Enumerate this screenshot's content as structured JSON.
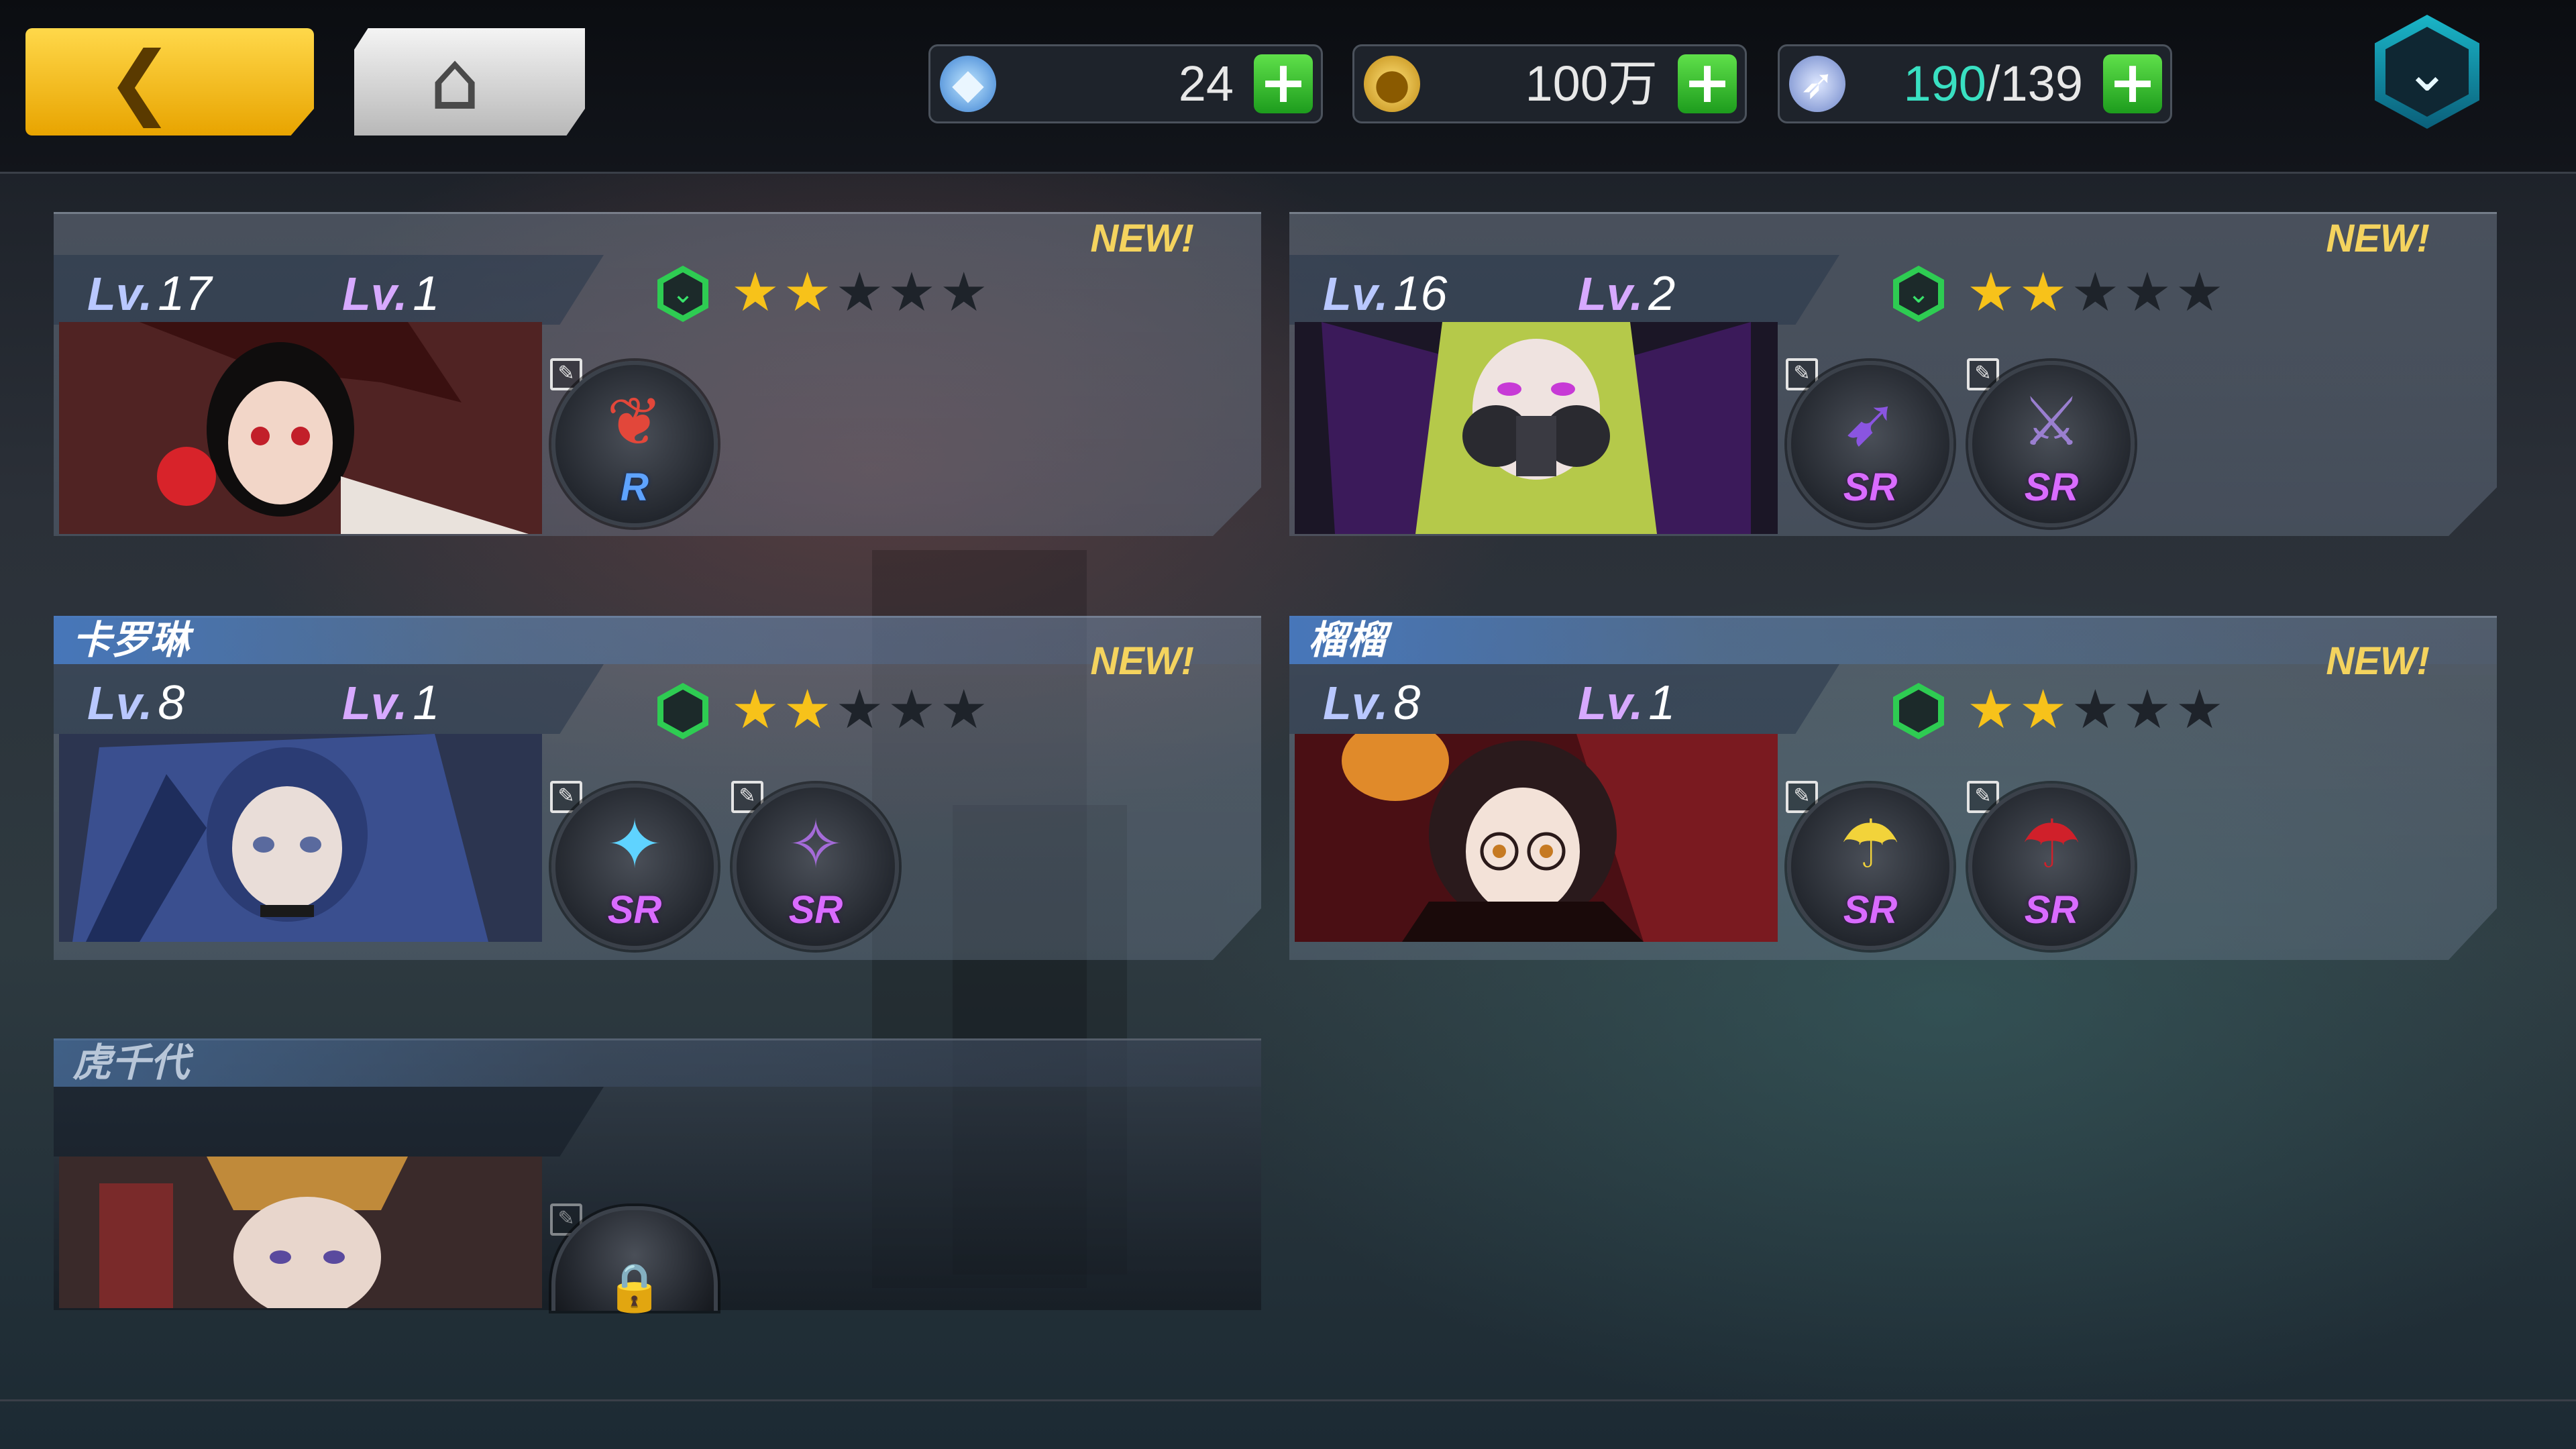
{
  "header": {
    "back_icon": "back-arrow-icon",
    "home_icon": "home-icon",
    "resources": [
      {
        "icon": "diamond-icon",
        "value": "24"
      },
      {
        "icon": "gold-coin-icon",
        "value": "100万"
      },
      {
        "icon": "stamina-icon",
        "current": "190",
        "separator": "/",
        "max": "139"
      }
    ],
    "menu_icon": "shield-chevron-icon"
  },
  "cards": [
    {
      "name": "",
      "new_badge": "NEW!",
      "level_label": "Lv.",
      "level": "17",
      "breakthrough_label": "Lv.",
      "breakthrough": "1",
      "stars_filled": 2,
      "stars_total": 5,
      "equipment": [
        {
          "rarity": "R",
          "icon": "rose-staff-icon"
        }
      ]
    },
    {
      "name": "",
      "new_badge": "NEW!",
      "level_label": "Lv.",
      "level": "16",
      "breakthrough_label": "Lv.",
      "breakthrough": "2",
      "stars_filled": 2,
      "stars_total": 5,
      "equipment": [
        {
          "rarity": "SR",
          "icon": "drill-weapon-icon"
        },
        {
          "rarity": "SR",
          "icon": "dual-blade-icon"
        }
      ]
    },
    {
      "name": "卡罗琳",
      "new_badge": "NEW!",
      "level_label": "Lv.",
      "level": "8",
      "breakthrough_label": "Lv.",
      "breakthrough": "1",
      "stars_filled": 2,
      "stars_total": 5,
      "equipment": [
        {
          "rarity": "SR",
          "icon": "twin-guns-icon"
        },
        {
          "rarity": "SR",
          "icon": "claw-blades-icon"
        }
      ]
    },
    {
      "name": "榴榴",
      "new_badge": "NEW!",
      "level_label": "Lv.",
      "level": "8",
      "breakthrough_label": "Lv.",
      "breakthrough": "1",
      "stars_filled": 2,
      "stars_total": 5,
      "equipment": [
        {
          "rarity": "SR",
          "icon": "yellow-parasol-icon"
        },
        {
          "rarity": "SR",
          "icon": "red-parasol-icon"
        }
      ]
    },
    {
      "name": "虎千代",
      "locked": true,
      "equipment": [
        {
          "rarity": "",
          "icon": "lock-icon"
        }
      ]
    }
  ],
  "colors": {
    "accent_gold": "#f4d35e",
    "star_on": "#f7c21a",
    "rarity_r": "#5ea3ff",
    "rarity_sr": "#d96bff",
    "stamina_current": "#39e0c2",
    "plus_green": "#2bb52b"
  }
}
